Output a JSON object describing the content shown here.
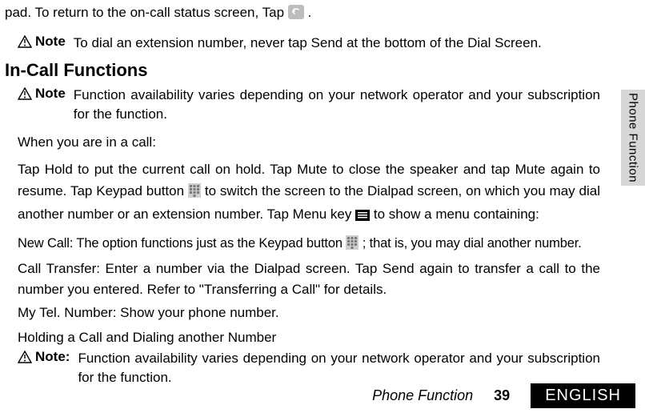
{
  "intro_line_prefix": "pad. To return to the on-call status screen, Tap ",
  "intro_line_suffix": ".",
  "note1": {
    "label": "Note",
    "text": "To dial an extension number, never tap Send at the bottom of the Dial Screen."
  },
  "heading": "In-Call Functions",
  "note2": {
    "label": "Note",
    "text": "Function availability varies depending on your network operator and your subscription for the function."
  },
  "para_lead": "When you are in a call:",
  "para_main_a": "Tap Hold to put the current call on hold. Tap Mute to close the speaker and tap Mute again to resume. Tap Keypad button",
  "para_main_b": "to switch the screen to the Dialpad screen, on which you may dial another number or an extension number. Tap Menu key",
  "para_main_c": " to show a menu containing:",
  "para_newcall_a": "New Call: The option functions just as the Keypad button",
  "para_newcall_b": "; that is, you may dial another number.",
  "para_transfer": "Call Transfer: Enter a number via the Dialpad screen. Tap Send again to transfer a call to the number you entered. Refer to \"Transferring a Call\" for details.",
  "para_mytel": "My Tel. Number: Show your phone number.",
  "subheading": "Holding a Call and Dialing another Number",
  "note3": {
    "label": "Note:",
    "text": "Function availability varies depending on your network operator and your subscription for the function."
  },
  "sidetab": "Phone Function",
  "footer": {
    "title": "Phone Function",
    "page": "39",
    "lang": "ENGLISH"
  }
}
